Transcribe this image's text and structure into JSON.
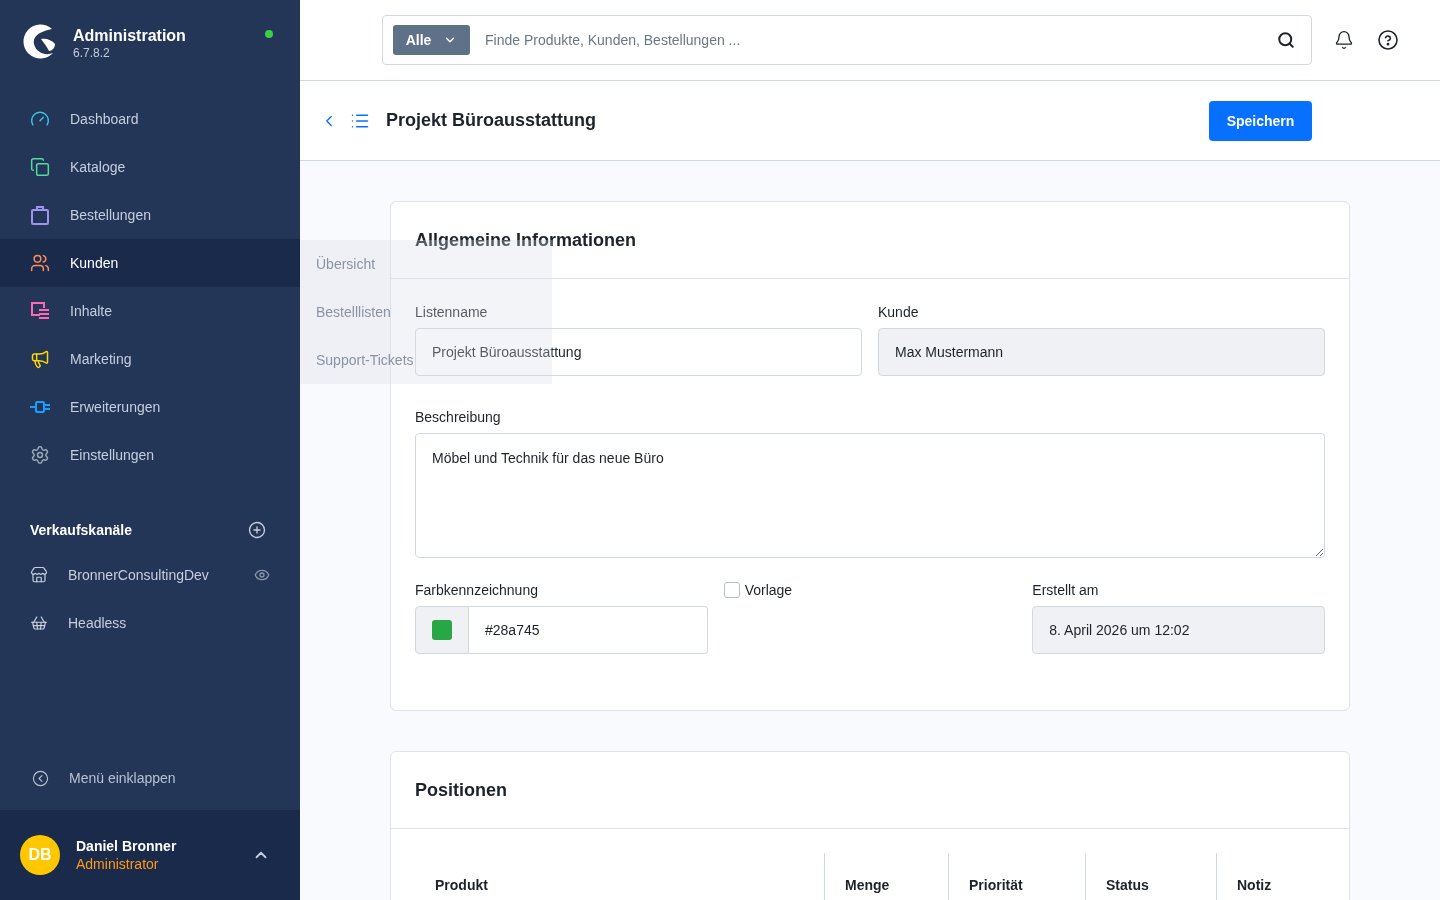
{
  "sidebar": {
    "app_title": "Administration",
    "version": "6.7.8.2",
    "online": true,
    "nav_items": [
      {
        "label": "Dashboard",
        "color": "#3ec1e6",
        "selected": false
      },
      {
        "label": "Kataloge",
        "color": "#57d9a3",
        "selected": false
      },
      {
        "label": "Bestellungen",
        "color": "#a092f0",
        "selected": false
      },
      {
        "label": "Kunden",
        "color": "#ff8a5b",
        "selected": true
      },
      {
        "label": "Inhalte",
        "color": "#ff68b4",
        "selected": false
      },
      {
        "label": "Marketing",
        "color": "#ffd600",
        "selected": false
      },
      {
        "label": "Erweiterungen",
        "color": "#189eff",
        "selected": false
      },
      {
        "label": "Einstellungen",
        "color": "#9aa8b5",
        "selected": false
      }
    ],
    "sales_channels": {
      "title": "Verkaufskanäle",
      "items": [
        {
          "label": "BronnerConsultingDev",
          "kind": "storefront",
          "preview": true
        },
        {
          "label": "Headless",
          "kind": "headless",
          "preview": false
        }
      ]
    },
    "collapse": "Menü einklappen",
    "user": {
      "initials": "DB",
      "name": "Daniel Bronner",
      "role": "Administrator"
    }
  },
  "flyout": {
    "items": [
      "Übersicht",
      "Bestelllisten",
      "Support-Tickets"
    ]
  },
  "top_bar": {
    "search": {
      "scope": "Alle",
      "placeholder": "Finde Produkte, Kunden, Bestellungen ..."
    }
  },
  "smart_bar": {
    "title": "Projekt Büroausstattung",
    "save_button": "Speichern"
  },
  "general_card": {
    "title": "Allgemeine Informationen",
    "list_name": {
      "label": "Listenname",
      "value": "Projekt Büroausstattung",
      "disabled": false
    },
    "customer": {
      "label": "Kunde",
      "value": "Max Mustermann",
      "disabled": true
    },
    "description": {
      "label": "Beschreibung",
      "value": "Möbel und Technik für das neue Büro"
    },
    "color_field": {
      "label": "Farbkennzeichnung",
      "value": "#28a745",
      "color": "#28a745"
    },
    "template": {
      "label": "Vorlage",
      "checked": false
    },
    "created": {
      "label": "Erstellt am",
      "value": "8. April 2026 um 12:02",
      "disabled": true
    }
  },
  "positions_card": {
    "title": "Positionen",
    "columns": [
      "Produkt",
      "Menge",
      "Priorität",
      "Status",
      "Notiz"
    ]
  }
}
